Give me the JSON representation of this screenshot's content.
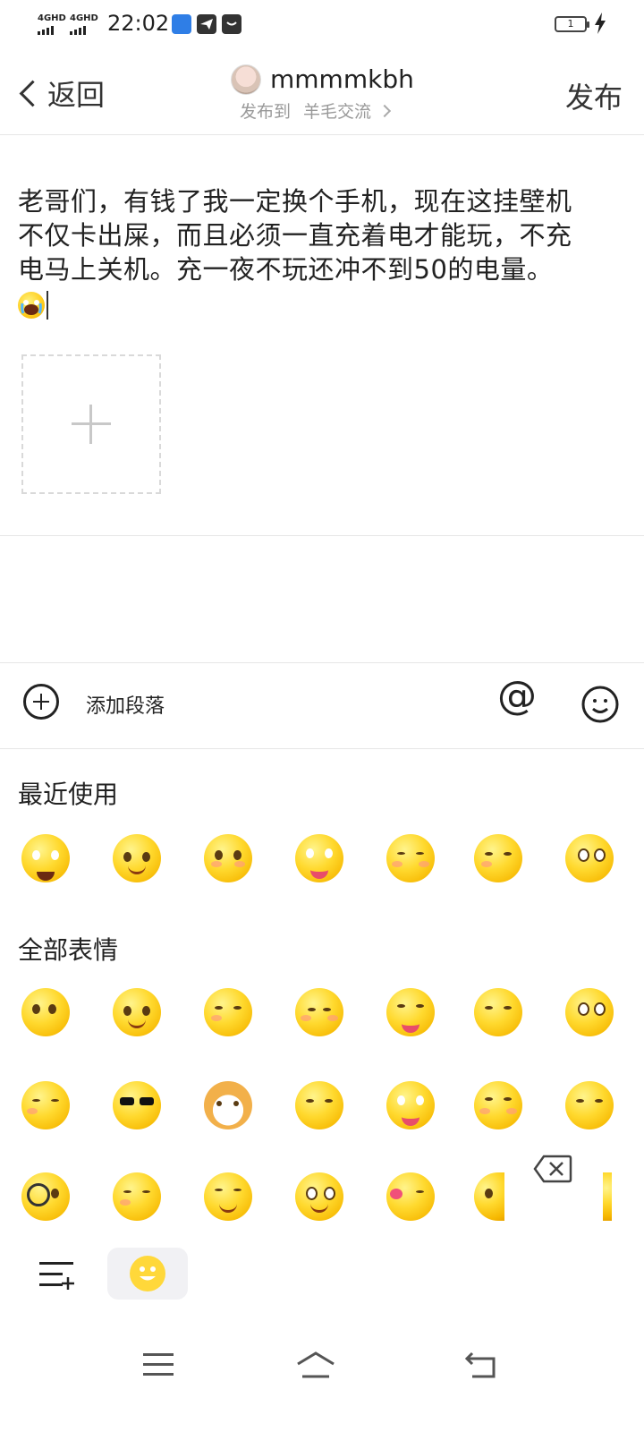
{
  "status_bar": {
    "signal_1": "4GHD",
    "signal_2": "4GHD",
    "time": "22:02",
    "battery": "1"
  },
  "header": {
    "back_label": "返回",
    "username": "mmmmkbh",
    "post_to_label": "发布到",
    "forum_name": "羊毛交流",
    "publish_label": "发布"
  },
  "post": {
    "text": "老哥们，有钱了我一定换个手机，现在这挂壁机不仅卡出屎，而且必须一直充着电才能玩，不充电马上关机。充一夜不玩还冲不到50的电量。",
    "inline_emoji": "crying-emoji"
  },
  "toolbar": {
    "add_paragraph_label": "添加段落",
    "mention_icon": "at-icon",
    "emoji_icon": "smile-icon"
  },
  "emoji_panel": {
    "recent_title": "最近使用",
    "all_title": "全部表情",
    "recent": [
      "crying",
      "laugh-cry",
      "yawn",
      "star-eyes",
      "sleepy",
      "smirk",
      "surprised"
    ],
    "all_row1": [
      "thinking",
      "laugh-cry",
      "smirk",
      "shy",
      "tongue",
      "thinking-hand",
      "surprised"
    ],
    "all_row2": [
      "tired",
      "cool-sunglasses",
      "shiba-dog",
      "thinking",
      "star-eyes",
      "eye-roll",
      "angry-hand"
    ],
    "all_row3": [
      "magnifier",
      "sneeze",
      "grin",
      "drool",
      "heart-kiss",
      "peek",
      "peek"
    ]
  },
  "colors": {
    "emoji_yellow": "#ffd92e",
    "divider": "#e6e6e6",
    "muted_text": "#999999"
  }
}
